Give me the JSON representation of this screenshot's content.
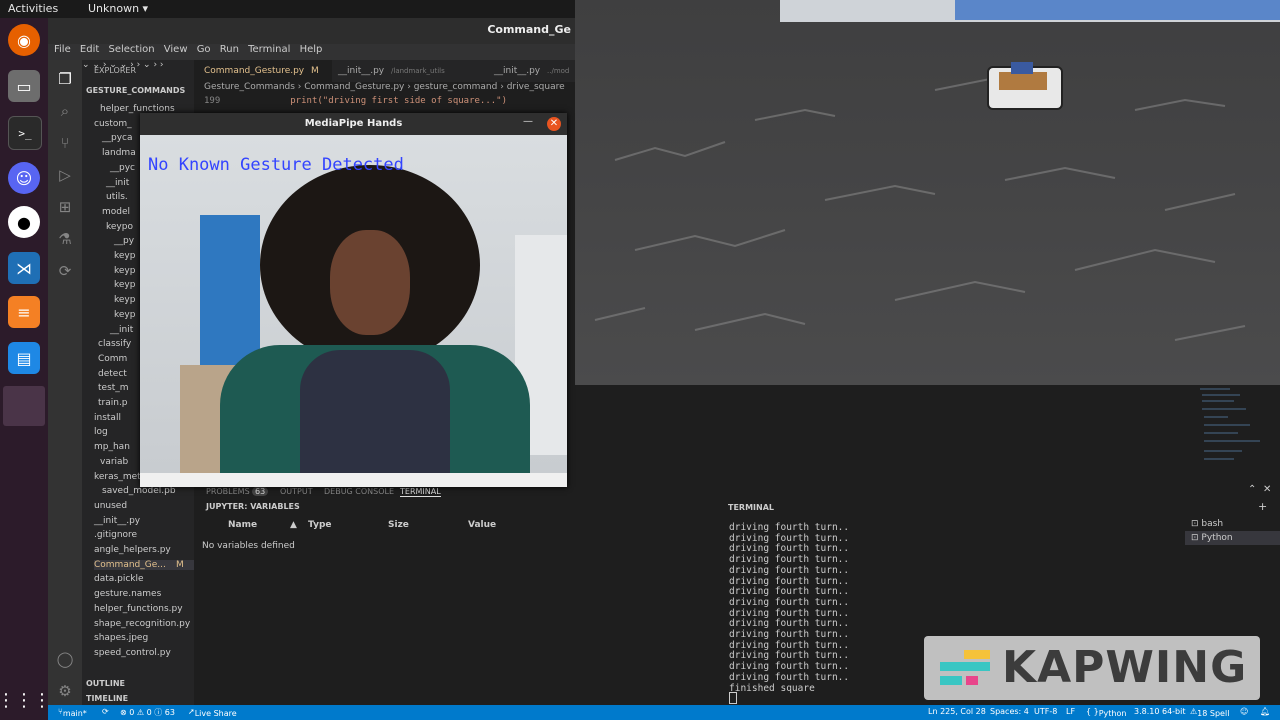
{
  "desktop": {
    "activities": "Activities",
    "workspace": "Unknown ▾"
  },
  "vscode": {
    "window_title": "Command_Ge",
    "menu": [
      "File",
      "Edit",
      "Selection",
      "View",
      "Go",
      "Run",
      "Terminal",
      "Help"
    ],
    "sidebar": {
      "title": "EXPLORER",
      "root": "GESTURE_COMMANDS",
      "items": [
        "helper_functions",
        "custom_",
        "__pyca",
        "landma",
        "__pyc",
        "__init",
        "utils.",
        "model",
        "keypo",
        "__py",
        "keyp",
        "keyp",
        "keyp",
        "keyp",
        "keyp",
        "__init",
        "classify",
        "Comm",
        "detect",
        "test_m",
        "train.p",
        "install",
        "log",
        "mp_han",
        "variab",
        "keras_metadata.pb",
        "saved_model.pb",
        "unused",
        "__init__.py",
        ".gitignore",
        "angle_helpers.py",
        "Command_Ge...",
        "data.pickle",
        "gesture.names",
        "helper_functions.py",
        "shape_recognition.py",
        "shapes.jpeg",
        "speed_control.py"
      ],
      "modified_marker": "M",
      "outline": "OUTLINE",
      "timeline": "TIMELINE"
    },
    "tabs": [
      {
        "label": "Command_Gesture.py",
        "badge": "M"
      },
      {
        "label": "__init__.py",
        "path": "/landmark_utils"
      },
      {
        "label": "__init__.py",
        "path": "../mod"
      }
    ],
    "breadcrumb": [
      "Gesture_Commands",
      "Command_Gesture.py",
      "gesture_command",
      "drive_square"
    ],
    "code": {
      "line_no": "199",
      "text": "print(\"driving first side of square...\")"
    },
    "panel_tabs": [
      "PROBLEMS",
      "63",
      "OUTPUT",
      "DEBUG CONSOLE",
      "TERMINAL"
    ],
    "jupyter_title": "JUPYTER: VARIABLES",
    "vars_columns": [
      "Name",
      "Type",
      "Size",
      "Value"
    ],
    "vars_empty": "No variables defined"
  },
  "terminal": {
    "title": "TERMINAL",
    "lines": [
      "driving fourth turn..",
      "driving fourth turn..",
      "driving fourth turn..",
      "driving fourth turn..",
      "driving fourth turn..",
      "driving fourth turn..",
      "driving fourth turn..",
      "driving fourth turn..",
      "driving fourth turn..",
      "driving fourth turn..",
      "driving fourth turn..",
      "driving fourth turn..",
      "driving fourth turn..",
      "driving fourth turn..",
      "driving fourth turn..",
      "finished square"
    ],
    "shells": [
      "bash",
      "Python"
    ]
  },
  "mediapipe": {
    "title": "MediaPipe Hands",
    "overlay": "No Known Gesture Detected"
  },
  "statusbar": {
    "branch": "main*",
    "errors": "⊗ 0 ⚠ 0 ⓘ 63",
    "live_share": "Live Share",
    "position": "Ln 225, Col 28",
    "spaces": "Spaces: 4",
    "encoding": "UTF-8",
    "eol": "LF",
    "language": "Python",
    "interpreter": "3.8.10 64-bit",
    "spell": "18 Spell"
  },
  "watermark": "KAPWING",
  "colors": {
    "accent": "#007acc",
    "overlay_text": "#3344ff",
    "dock": "#2c1b2a",
    "close_button": "#e95420"
  }
}
